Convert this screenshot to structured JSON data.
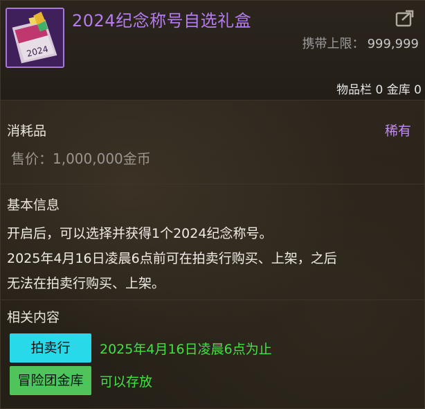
{
  "item": {
    "title": "2024纪念称号自选礼盒",
    "icon": "gift-box-icon",
    "carry_label": "携带上限：",
    "carry_value": "999,999",
    "storage": "物品栏 0 金库 0"
  },
  "category": {
    "label": "消耗品",
    "rarity": "稀有",
    "price": "售价：1,000,000金币"
  },
  "basic_info": {
    "heading": "基本信息",
    "lines": [
      "开启后，可以选择并获得1个2024纪念称号。",
      "2025年4月16日凌晨6点前可在拍卖行购买、上架，之后",
      "无法在拍卖行购买、上架。"
    ]
  },
  "related": {
    "heading": "相关内容",
    "rows": [
      {
        "button": "拍卖行",
        "text": "2025年4月16日凌晨6点为止"
      },
      {
        "button": "冒险团金库",
        "text": "可以存放"
      }
    ]
  },
  "colors": {
    "title": "#b57cf0",
    "rarity": "#c38cf5",
    "auction_button": "#28d9ea",
    "bank_button": "#4ec45a",
    "related_text": "#44e044"
  }
}
